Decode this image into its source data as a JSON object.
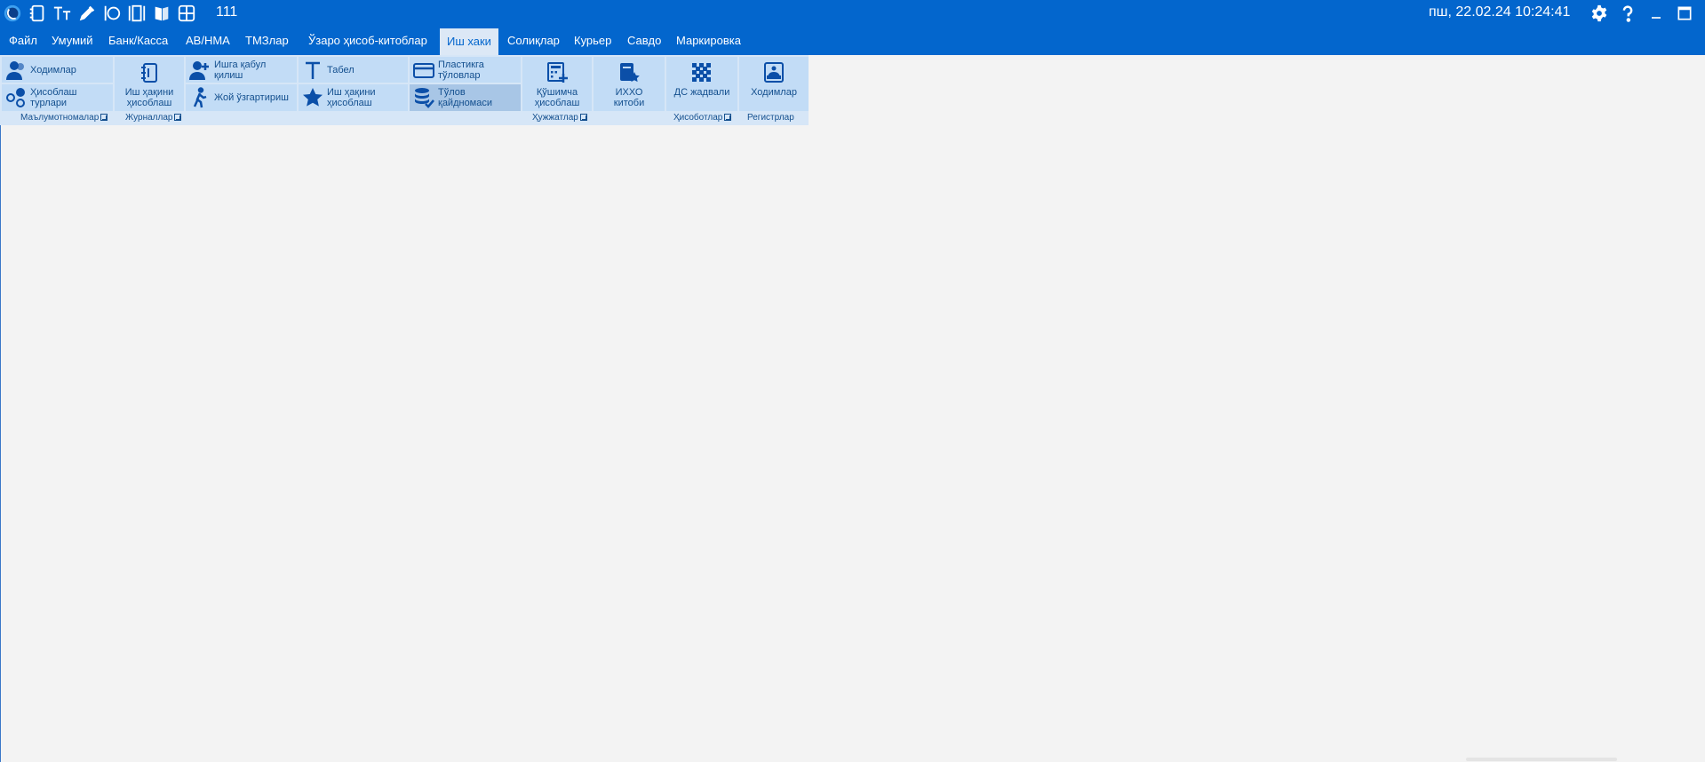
{
  "titlebar": {
    "counter": "111",
    "datetime": "пш, 22.02.24 10:24:41",
    "icons": [
      "app-logo-icon",
      "notebook-icon",
      "font-size-icon",
      "pen-icon",
      "columns-icon",
      "panels-icon",
      "book-icon",
      "calculator-grid-icon"
    ],
    "right_icons": [
      "settings-icon",
      "help-icon",
      "minimize-icon",
      "maximize-icon",
      "close-icon"
    ]
  },
  "menu": {
    "items": [
      "Файл",
      "Умумий",
      "Банк/Касса",
      "АВ/НМА",
      "ТМЗлар",
      "Ўзаро ҳисоб-китоблар",
      "Иш хаки",
      "Солиқлар",
      "Курьер",
      "Савдо",
      "Маркировка"
    ],
    "active": "Иш хаки"
  },
  "ribbon": {
    "buttons": {
      "employees": "Ходимлар",
      "calc_types": "Ҳисоблаш\nтурлари",
      "payroll": "Иш ҳақини\nҳисоблаш",
      "hire": "Ишга қабул\nқилиш",
      "transfer": "Жой ўзгартириш",
      "timesheet": "Табел",
      "payroll_calc": "Иш ҳақини\nҳисоблаш",
      "card_payments": "Пластикга\nтўловлар",
      "payment_list": "Тўлов\nқайдномаси",
      "extra_calc": "Қўшимча\nҳисоблаш",
      "ihxo_book": "ИХХО\nкитоби",
      "ds_table": "ДС жадвали",
      "reg_employees": "Ходимлар"
    },
    "groups": {
      "references": "Маълумотномалар",
      "journals": "Журналлар",
      "documents": "Ҳужжатлар",
      "reports": "Ҳисоботлар",
      "registers": "Регистрлар"
    }
  },
  "colors": {
    "titlebar": "#0366cd",
    "ribbon_bg": "#d6e6f7",
    "button_bg": "#c2dcf6",
    "button_selected": "#a8c6e6",
    "icon": "#0b4fa8",
    "workspace": "#f3f3f3"
  }
}
